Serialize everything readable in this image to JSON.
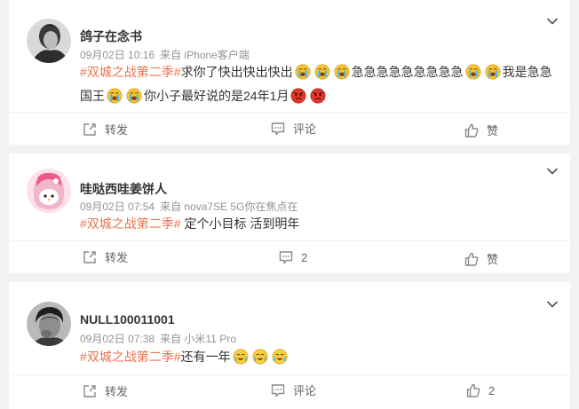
{
  "posts": [
    {
      "username": "鸽子在念书",
      "date": "09月02日 10:16",
      "source": "来自 iPhone客户端",
      "hashtag": "#双城之战第二季#",
      "text_a": "求你了快出快出快出",
      "text_b": "急急急急急急急急急",
      "text_c": "我是急急国王",
      "text_d": "你小子最好说的是24年1月",
      "actions": {
        "repost": "转发",
        "comment": "评论",
        "like": "赞"
      }
    },
    {
      "username": "哇哒西哇姜饼人",
      "date": "09月02日 07:54",
      "source": "来自 nova7SE 5G你在焦点在",
      "hashtag": "#双城之战第二季#",
      "text_a": " 定个小目标 活到明年",
      "actions": {
        "repost": "转发",
        "comment": "2",
        "like": "赞"
      }
    },
    {
      "username": "NULL100011001",
      "date": "09月02日 07:38",
      "source": "来自 小米11 Pro",
      "hashtag": "#双城之战第二季#",
      "text_a": "还有一年",
      "actions": {
        "repost": "转发",
        "comment": "评论",
        "like": "2"
      }
    }
  ],
  "icons": {
    "more": "chevron-down-icon",
    "repost": "repost-icon",
    "comment": "comment-icon",
    "like": "thumbs-up-icon",
    "emoji_cry": "crying-emoji",
    "emoji_angry": "angry-emoji",
    "emoji_tears": "tears-of-joy-emoji"
  },
  "colors": {
    "hashtag": "#eb7350",
    "meta": "#939393",
    "background": "#f2f2f2"
  }
}
